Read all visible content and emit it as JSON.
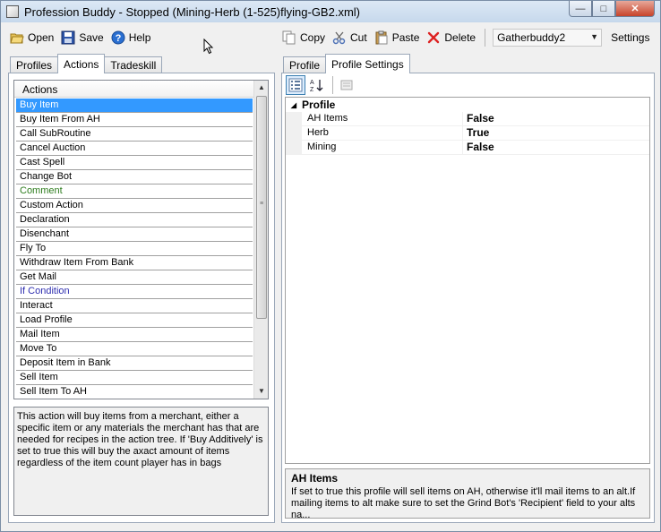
{
  "window": {
    "title": "Profession Buddy - Stopped (Mining-Herb (1-525)flying-GB2.xml)"
  },
  "toolbar_left": {
    "open_label": "Open",
    "save_label": "Save",
    "help_label": "Help"
  },
  "toolbar_right": {
    "copy_label": "Copy",
    "cut_label": "Cut",
    "paste_label": "Paste",
    "delete_label": "Delete",
    "bot_combo_value": "Gatherbuddy2",
    "settings_label": "Settings"
  },
  "left_tabs": [
    "Profiles",
    "Actions",
    "Tradeskill"
  ],
  "right_tabs": [
    "Profile",
    "Profile Settings"
  ],
  "actions_list": {
    "header": "Actions",
    "items": [
      "Buy Item",
      "Buy Item From AH",
      "Call SubRoutine",
      "Cancel Auction",
      "Cast Spell",
      "Change Bot",
      "Comment",
      "Custom Action",
      "Declaration",
      "Disenchant",
      "Fly To",
      "Withdraw Item From Bank",
      "Get Mail",
      "If Condition",
      "Interact",
      "Load Profile",
      "Mail Item",
      "Move To",
      "Deposit Item in Bank",
      "Sell Item",
      "Sell Item To AH"
    ],
    "selected": "Buy Item"
  },
  "action_description": "This action will buy items from a merchant, either a specific item or any materials the merchant has that are needed for recipes in the action tree. If 'Buy Additively' is set to true this will buy the axact amount of items regardless of the item count player has in bags",
  "property_grid": {
    "category": "Profile",
    "rows": [
      {
        "name": "AH Items",
        "value": "False"
      },
      {
        "name": "Herb",
        "value": "True"
      },
      {
        "name": "Mining",
        "value": "False"
      }
    ],
    "help_title": "AH Items",
    "help_text": "If set to true this profile will sell items on AH, otherwise it'll mail items to an alt.If mailing items to alt make sure to set the Grind Bot's 'Recipient' field to your alts na..."
  },
  "colors": {
    "selection": "#3399ff",
    "comment_item": "#2e7d1e",
    "condition_item": "#2f2fb0"
  }
}
